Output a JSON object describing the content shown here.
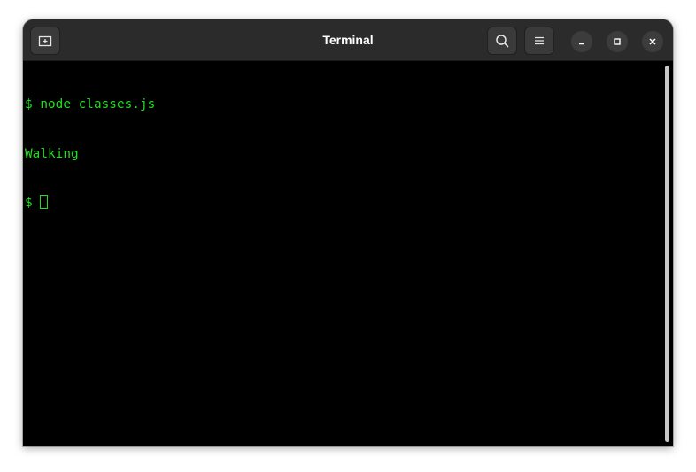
{
  "window": {
    "title": "Terminal"
  },
  "header": {
    "new_tab_icon": "new-tab-icon",
    "search_icon": "search-icon",
    "menu_icon": "hamburger-menu-icon"
  },
  "terminal": {
    "lines": [
      {
        "text": "$ node classes.js"
      },
      {
        "text": "Walking"
      },
      {
        "text": "$ "
      }
    ],
    "text_color": "#22dd22",
    "background": "#000000"
  }
}
